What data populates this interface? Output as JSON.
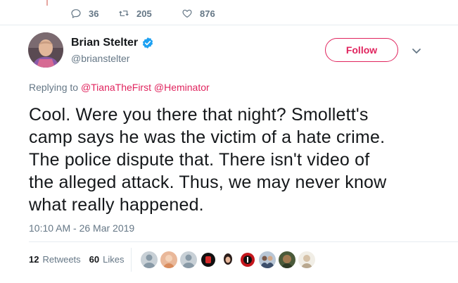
{
  "top_actions": {
    "replies": "36",
    "retweets": "205",
    "likes": "876"
  },
  "author": {
    "name": "Brian Stelter",
    "handle": "@brianstelter",
    "verified_icon": "verified-badge-icon"
  },
  "follow_label": "Follow",
  "replying": {
    "prefix": "Replying to",
    "mention_1": "@TianaTheFirst",
    "mention_2": "@Heminator"
  },
  "tweet": {
    "lines": [
      "Cool. Were you there that night? Smollett's",
      "camp says he was the victim of a hate crime.",
      "The police dispute that. There isn't video of",
      "the alleged attack. Thus, we may never know",
      "what really happened."
    ]
  },
  "timestamp": "10:10 AM - 26 Mar 2019",
  "stats": {
    "retweets_count": "12",
    "retweets_label": "Retweets",
    "likes_count": "60",
    "likes_label": "Likes"
  },
  "colors": {
    "accent": "#e0245e",
    "muted": "#657786",
    "verified": "#1da1f2"
  }
}
